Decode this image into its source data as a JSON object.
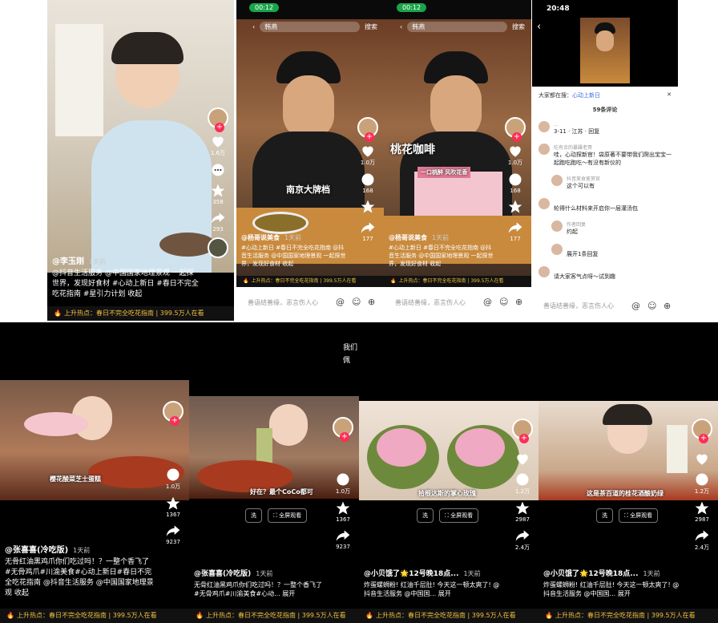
{
  "colors": {
    "accent": "#fe2c55",
    "hot": "#f0c040",
    "status_pill": "#1aa34a"
  },
  "p1": {
    "author": "@李玉刚",
    "time": "1天前",
    "caption": "@抖音生活服务 @中国国家地理景观 一起探世界，发现好食材 #心动上新日 #春日不完全吃花指南 #星引力计划 收起",
    "likes": "1.6万",
    "favs": "358",
    "shares": "293",
    "hot": "上升热点：春日不完全吃花指南 | 399.5万人在看"
  },
  "p2": {
    "status": "00:12",
    "search": "搜索",
    "search_text": "韩燕",
    "overlay": "南京大牌档",
    "author": "@杨哥说美食",
    "time": "1天前",
    "caption": "#心动上新日 #春日不完全吃花指南 @抖音生活服务 @中国国家地理景观 一起探世界，发现好食材 收起",
    "likes": "1.0万",
    "comments": "168",
    "favs": "177",
    "hot": "上升热点：春日不完全吃花指南 | 399.5万人在看",
    "input": "善语结善缘，恶言伤人心"
  },
  "p3": {
    "status": "00:12",
    "search": "搜索",
    "search_text": "韩燕",
    "overlay": "桃花咖啡",
    "banner": "一口桃醉 风吹花香",
    "author": "@杨哥说美食",
    "time": "1天前",
    "caption": "#心动上新日 #春日不完全吃花指南 @抖音生活服务 @中国国家地理景观 一起探世界，发现好食材 收起",
    "likes": "1.0万",
    "comments": "168",
    "favs": "177",
    "hot": "上升热点：春日不完全吃花指南 | 399.5万人在看",
    "input": "善语结善缘，恶言伤人心"
  },
  "p4": {
    "time": "20:48",
    "everyone": "大家都在搜：",
    "everyone_link": "心动上新日",
    "count": "59条评论",
    "comments": [
      {
        "name": "…",
        "text": "3-11 · 江苏 · 回复",
        "sub": false
      },
      {
        "name": "吃有余的暴躁老哥",
        "text": "哇，心动探新官！袋原著不要带我们爬出宝宝一起跑吃跑吃～有没有新仪的",
        "sub": false
      },
      {
        "name": "抖音美食鉴赏官",
        "text": "这个可以有",
        "sub": true
      },
      {
        "name": "",
        "text": "轮得什么材料来开启你一层灌汤包",
        "sub": false
      },
      {
        "name": "作者回复",
        "text": "约起",
        "sub": true
      },
      {
        "name": "",
        "text": "展开1条回复",
        "sub": true
      },
      {
        "name": "",
        "text": "请大家客气点呀～试到趣",
        "sub": false
      }
    ],
    "input": "善语结善缘，恶言伤人心"
  },
  "p5": {
    "sub": "樱花酸菜芝士蛋糕",
    "author": "@张喜喜(冷吃版)",
    "time": "1天前",
    "caption": "无骨红油黑鸡爪你们吃过吗！？一整个香飞了 #无骨鸡爪#川渝美食#心动上新日#春日不完全吃花指南 @抖音生活服务 @中国国家地理景观 收起",
    "likes": "1.0万",
    "favs": "1367",
    "shares": "9237",
    "hot": "上升热点：春日不完全吃花指南 | 399.5万人在看"
  },
  "p6": {
    "top": "我们\n佩",
    "sub": "好在？最个CoCo都可",
    "btn1": "洗",
    "btn2": "全屏观看",
    "author": "@张喜喜(冷吃版)",
    "time": "1天前",
    "caption": "无骨红油黑鸡爪你们吃过吗！？一整个香飞了 #无骨鸡爪#川渝美食#心动... 展开",
    "likes": "1.0万",
    "favs": "1367",
    "shares": "9237",
    "hot": "上升热点：春日不完全吃花指南 | 399.5万人在看"
  },
  "p7": {
    "sub": "拾根达斯的掌心玫瑰",
    "btn1": "洗",
    "btn2": "全屏观看",
    "author": "@小贝饿了🌟12号晚18点...",
    "time": "1天前",
    "caption": "炸蛋螺蛳粉! 红油千层肚! 今天这一顿太爽了! @抖音生活服务 @中国国... 展开",
    "likes": "1.2万",
    "favs": "2987",
    "shares": "2.4万",
    "hot": "上升热点：春日不完全吃花指南 | 399.5万人在看"
  },
  "p8": {
    "sub": "这是茶百道的桂花酒酿奶绿",
    "btn1": "洗",
    "btn2": "全屏观看",
    "author": "@小贝饿了🌟12号晚18点...",
    "time": "1天前",
    "caption": "炸蛋螺蛳粉! 红油千层肚! 今天这一顿太爽了! @抖音生活服务 @中国国... 展开",
    "likes": "1.2万",
    "favs": "2987",
    "shares": "2.4万",
    "hot": "上升热点：春日不完全吃花指南 | 399.5万人在看"
  }
}
